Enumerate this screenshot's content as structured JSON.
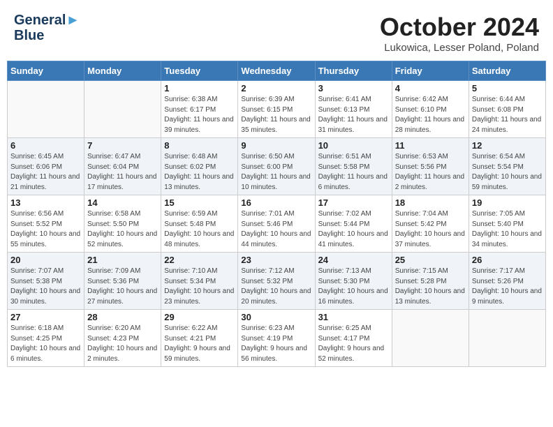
{
  "header": {
    "logo_line1": "General",
    "logo_line2": "Blue",
    "month_title": "October 2024",
    "location": "Lukowica, Lesser Poland, Poland"
  },
  "weekdays": [
    "Sunday",
    "Monday",
    "Tuesday",
    "Wednesday",
    "Thursday",
    "Friday",
    "Saturday"
  ],
  "weeks": [
    [
      {
        "day": "",
        "sunrise": "",
        "sunset": "",
        "daylight": ""
      },
      {
        "day": "",
        "sunrise": "",
        "sunset": "",
        "daylight": ""
      },
      {
        "day": "1",
        "sunrise": "Sunrise: 6:38 AM",
        "sunset": "Sunset: 6:17 PM",
        "daylight": "Daylight: 11 hours and 39 minutes."
      },
      {
        "day": "2",
        "sunrise": "Sunrise: 6:39 AM",
        "sunset": "Sunset: 6:15 PM",
        "daylight": "Daylight: 11 hours and 35 minutes."
      },
      {
        "day": "3",
        "sunrise": "Sunrise: 6:41 AM",
        "sunset": "Sunset: 6:13 PM",
        "daylight": "Daylight: 11 hours and 31 minutes."
      },
      {
        "day": "4",
        "sunrise": "Sunrise: 6:42 AM",
        "sunset": "Sunset: 6:10 PM",
        "daylight": "Daylight: 11 hours and 28 minutes."
      },
      {
        "day": "5",
        "sunrise": "Sunrise: 6:44 AM",
        "sunset": "Sunset: 6:08 PM",
        "daylight": "Daylight: 11 hours and 24 minutes."
      }
    ],
    [
      {
        "day": "6",
        "sunrise": "Sunrise: 6:45 AM",
        "sunset": "Sunset: 6:06 PM",
        "daylight": "Daylight: 11 hours and 21 minutes."
      },
      {
        "day": "7",
        "sunrise": "Sunrise: 6:47 AM",
        "sunset": "Sunset: 6:04 PM",
        "daylight": "Daylight: 11 hours and 17 minutes."
      },
      {
        "day": "8",
        "sunrise": "Sunrise: 6:48 AM",
        "sunset": "Sunset: 6:02 PM",
        "daylight": "Daylight: 11 hours and 13 minutes."
      },
      {
        "day": "9",
        "sunrise": "Sunrise: 6:50 AM",
        "sunset": "Sunset: 6:00 PM",
        "daylight": "Daylight: 11 hours and 10 minutes."
      },
      {
        "day": "10",
        "sunrise": "Sunrise: 6:51 AM",
        "sunset": "Sunset: 5:58 PM",
        "daylight": "Daylight: 11 hours and 6 minutes."
      },
      {
        "day": "11",
        "sunrise": "Sunrise: 6:53 AM",
        "sunset": "Sunset: 5:56 PM",
        "daylight": "Daylight: 11 hours and 2 minutes."
      },
      {
        "day": "12",
        "sunrise": "Sunrise: 6:54 AM",
        "sunset": "Sunset: 5:54 PM",
        "daylight": "Daylight: 10 hours and 59 minutes."
      }
    ],
    [
      {
        "day": "13",
        "sunrise": "Sunrise: 6:56 AM",
        "sunset": "Sunset: 5:52 PM",
        "daylight": "Daylight: 10 hours and 55 minutes."
      },
      {
        "day": "14",
        "sunrise": "Sunrise: 6:58 AM",
        "sunset": "Sunset: 5:50 PM",
        "daylight": "Daylight: 10 hours and 52 minutes."
      },
      {
        "day": "15",
        "sunrise": "Sunrise: 6:59 AM",
        "sunset": "Sunset: 5:48 PM",
        "daylight": "Daylight: 10 hours and 48 minutes."
      },
      {
        "day": "16",
        "sunrise": "Sunrise: 7:01 AM",
        "sunset": "Sunset: 5:46 PM",
        "daylight": "Daylight: 10 hours and 44 minutes."
      },
      {
        "day": "17",
        "sunrise": "Sunrise: 7:02 AM",
        "sunset": "Sunset: 5:44 PM",
        "daylight": "Daylight: 10 hours and 41 minutes."
      },
      {
        "day": "18",
        "sunrise": "Sunrise: 7:04 AM",
        "sunset": "Sunset: 5:42 PM",
        "daylight": "Daylight: 10 hours and 37 minutes."
      },
      {
        "day": "19",
        "sunrise": "Sunrise: 7:05 AM",
        "sunset": "Sunset: 5:40 PM",
        "daylight": "Daylight: 10 hours and 34 minutes."
      }
    ],
    [
      {
        "day": "20",
        "sunrise": "Sunrise: 7:07 AM",
        "sunset": "Sunset: 5:38 PM",
        "daylight": "Daylight: 10 hours and 30 minutes."
      },
      {
        "day": "21",
        "sunrise": "Sunrise: 7:09 AM",
        "sunset": "Sunset: 5:36 PM",
        "daylight": "Daylight: 10 hours and 27 minutes."
      },
      {
        "day": "22",
        "sunrise": "Sunrise: 7:10 AM",
        "sunset": "Sunset: 5:34 PM",
        "daylight": "Daylight: 10 hours and 23 minutes."
      },
      {
        "day": "23",
        "sunrise": "Sunrise: 7:12 AM",
        "sunset": "Sunset: 5:32 PM",
        "daylight": "Daylight: 10 hours and 20 minutes."
      },
      {
        "day": "24",
        "sunrise": "Sunrise: 7:13 AM",
        "sunset": "Sunset: 5:30 PM",
        "daylight": "Daylight: 10 hours and 16 minutes."
      },
      {
        "day": "25",
        "sunrise": "Sunrise: 7:15 AM",
        "sunset": "Sunset: 5:28 PM",
        "daylight": "Daylight: 10 hours and 13 minutes."
      },
      {
        "day": "26",
        "sunrise": "Sunrise: 7:17 AM",
        "sunset": "Sunset: 5:26 PM",
        "daylight": "Daylight: 10 hours and 9 minutes."
      }
    ],
    [
      {
        "day": "27",
        "sunrise": "Sunrise: 6:18 AM",
        "sunset": "Sunset: 4:25 PM",
        "daylight": "Daylight: 10 hours and 6 minutes."
      },
      {
        "day": "28",
        "sunrise": "Sunrise: 6:20 AM",
        "sunset": "Sunset: 4:23 PM",
        "daylight": "Daylight: 10 hours and 2 minutes."
      },
      {
        "day": "29",
        "sunrise": "Sunrise: 6:22 AM",
        "sunset": "Sunset: 4:21 PM",
        "daylight": "Daylight: 9 hours and 59 minutes."
      },
      {
        "day": "30",
        "sunrise": "Sunrise: 6:23 AM",
        "sunset": "Sunset: 4:19 PM",
        "daylight": "Daylight: 9 hours and 56 minutes."
      },
      {
        "day": "31",
        "sunrise": "Sunrise: 6:25 AM",
        "sunset": "Sunset: 4:17 PM",
        "daylight": "Daylight: 9 hours and 52 minutes."
      },
      {
        "day": "",
        "sunrise": "",
        "sunset": "",
        "daylight": ""
      },
      {
        "day": "",
        "sunrise": "",
        "sunset": "",
        "daylight": ""
      }
    ]
  ]
}
